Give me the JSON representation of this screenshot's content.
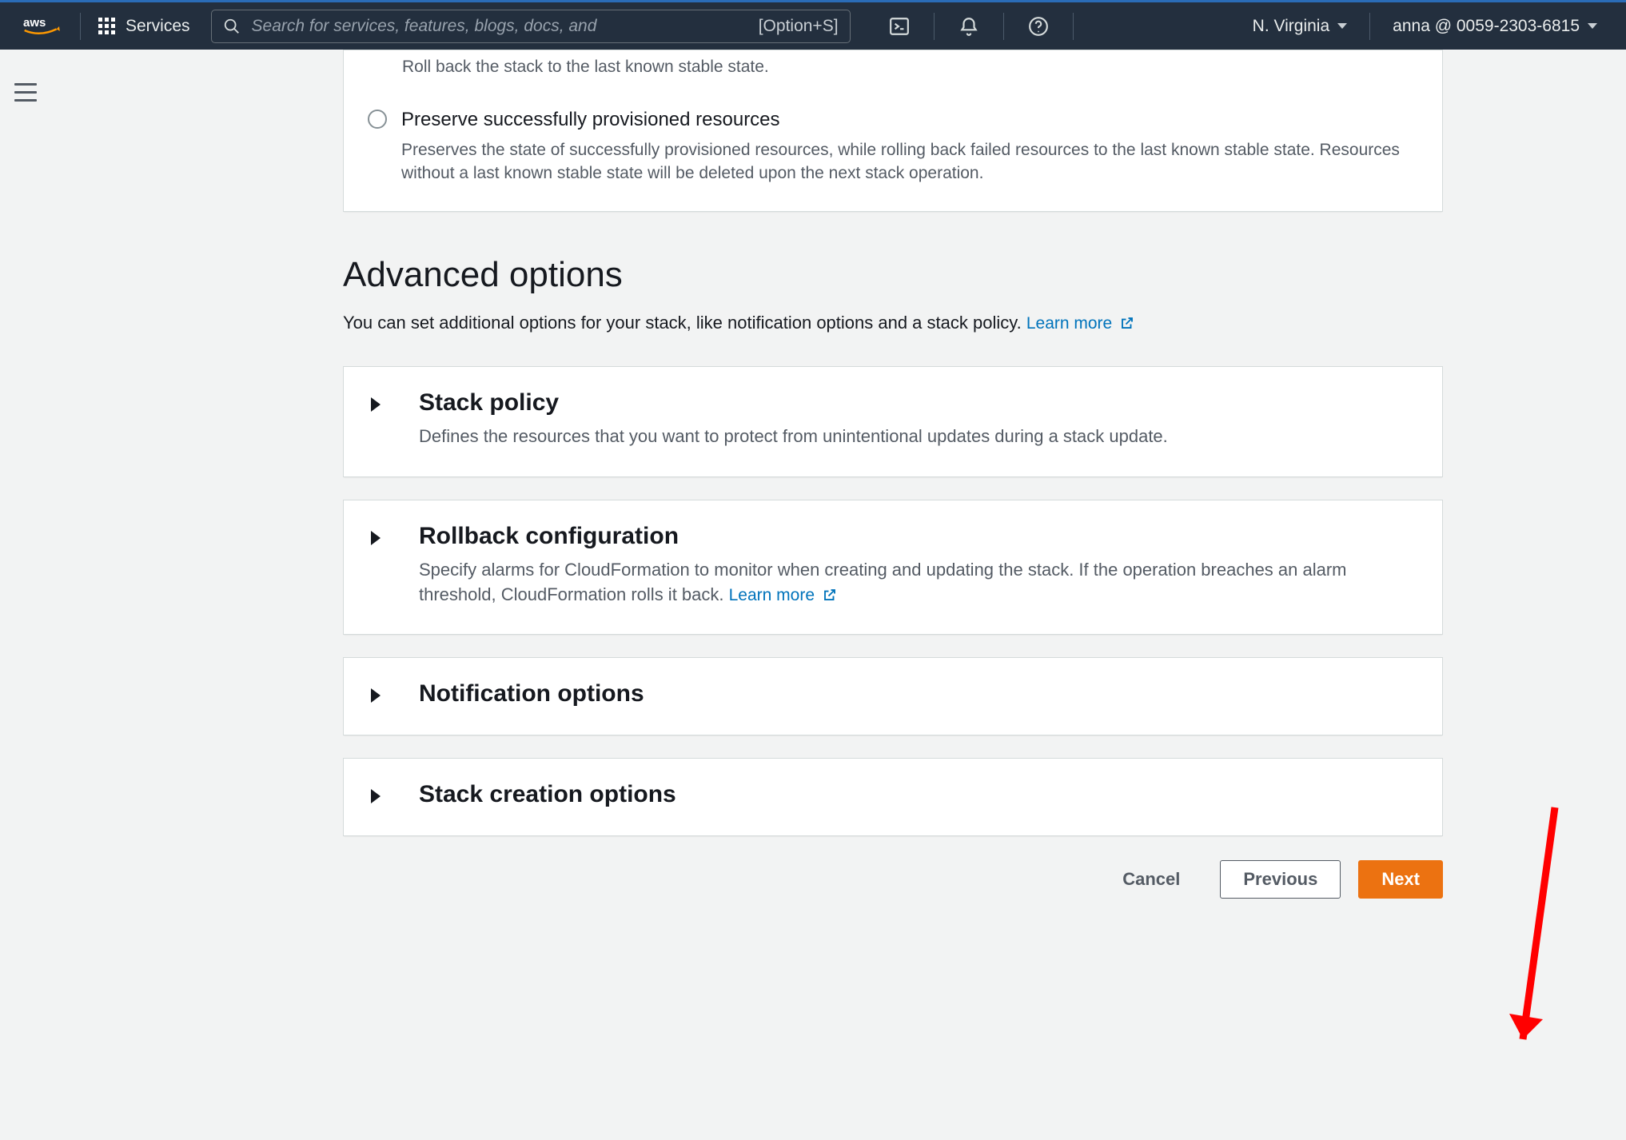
{
  "nav": {
    "services": "Services",
    "search_placeholder": "Search for services, features, blogs, docs, and",
    "search_hint": "[Option+S]",
    "region": "N. Virginia",
    "account": "anna @ 0059-2303-6815"
  },
  "rollback": {
    "opt1_desc": "Roll back the stack to the last known stable state.",
    "opt2_label": "Preserve successfully provisioned resources",
    "opt2_desc": "Preserves the state of successfully provisioned resources, while rolling back failed resources to the last known stable state. Resources without a last known stable state will be deleted upon the next stack operation."
  },
  "advanced": {
    "title": "Advanced options",
    "description": "You can set additional options for your stack, like notification options and a stack policy.",
    "learn_more": "Learn more"
  },
  "expandos": {
    "stack_policy": {
      "title": "Stack policy",
      "desc": "Defines the resources that you want to protect from unintentional updates during a stack update."
    },
    "rollback_config": {
      "title": "Rollback configuration",
      "desc": "Specify alarms for CloudFormation to monitor when creating and updating the stack. If the operation breaches an alarm threshold, CloudFormation rolls it back.",
      "learn_more": "Learn more"
    },
    "notification": {
      "title": "Notification options"
    },
    "creation": {
      "title": "Stack creation options"
    }
  },
  "buttons": {
    "cancel": "Cancel",
    "previous": "Previous",
    "next": "Next"
  }
}
